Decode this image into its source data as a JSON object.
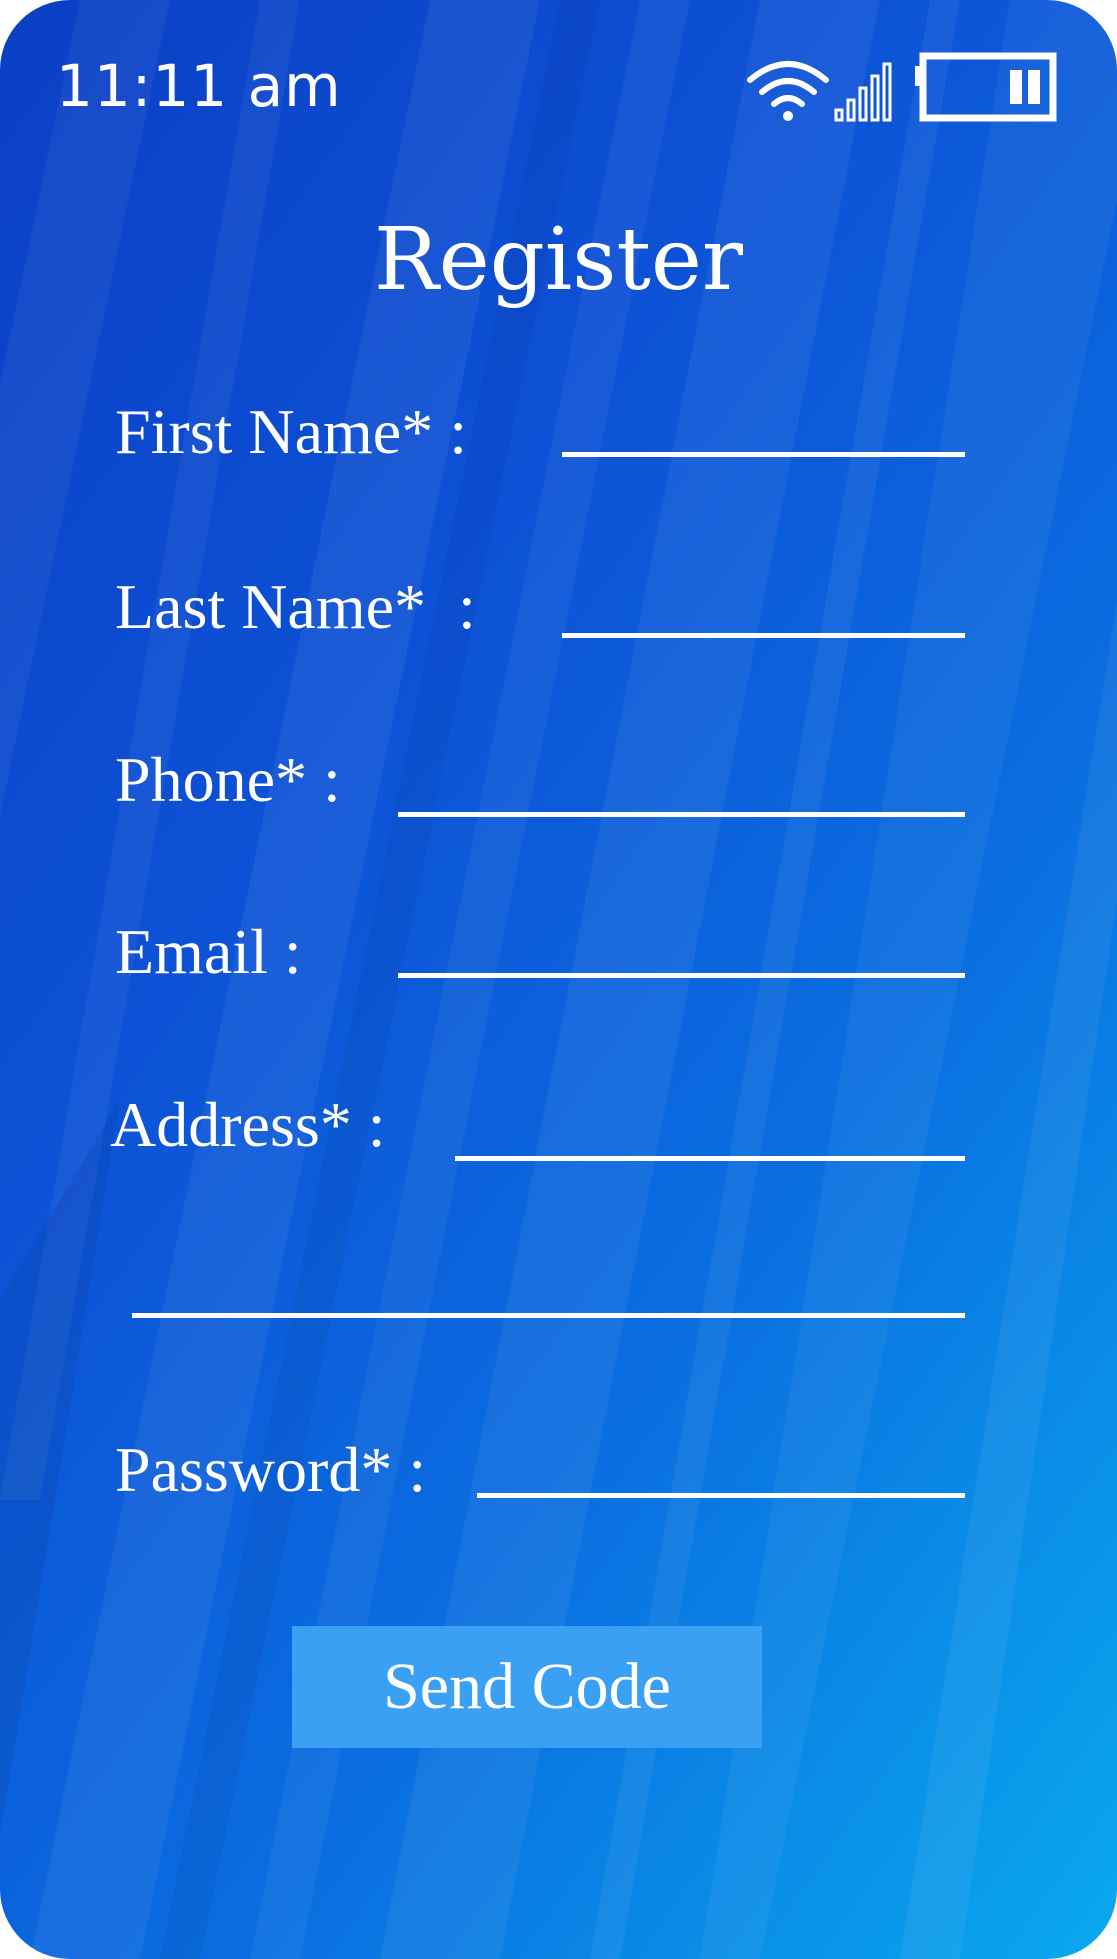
{
  "status_bar": {
    "time": "11:11 am"
  },
  "title": "Register",
  "fields": {
    "first_name_label": "First Name* :",
    "last_name_label": "Last Name*  :",
    "phone_label": "Phone* :",
    "email_label": "Email :",
    "address_label": "Address* :",
    "password_label": "Password* :"
  },
  "send_code_label": "Send Code",
  "colors": {
    "background_start": "#0b3fc4",
    "background_end": "#0aa9ee",
    "button": "#3aa0f3",
    "text": "#ffffff"
  }
}
